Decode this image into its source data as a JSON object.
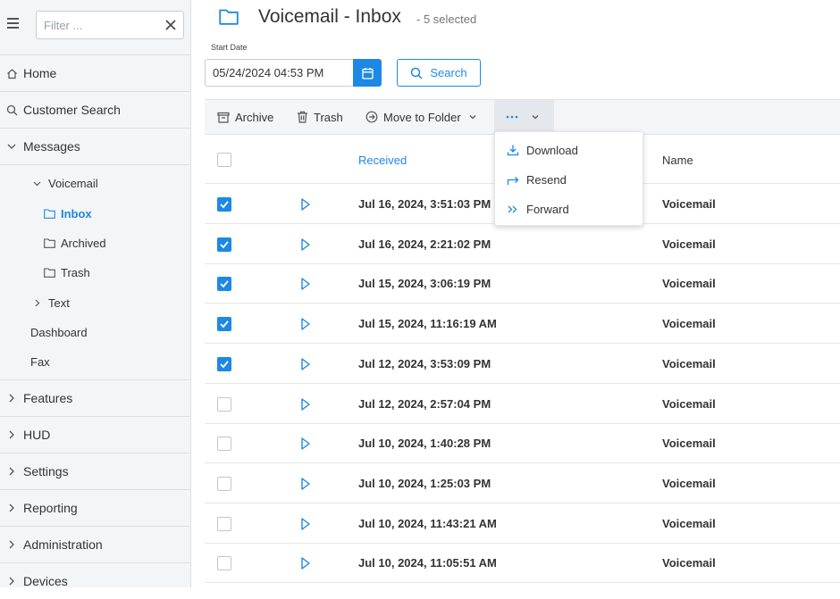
{
  "sidebar": {
    "filter_placeholder": "Filter ...",
    "nav": {
      "home": "Home",
      "customer_search": "Customer Search",
      "messages": "Messages",
      "voicemail": "Voicemail",
      "inbox": "Inbox",
      "archived": "Archived",
      "trash": "Trash",
      "text": "Text",
      "dashboard": "Dashboard",
      "fax": "Fax",
      "features": "Features",
      "hud": "HUD",
      "settings": "Settings",
      "reporting": "Reporting",
      "administration": "Administration",
      "devices": "Devices"
    }
  },
  "header": {
    "title": "Voicemail - Inbox",
    "selected": "- 5 selected"
  },
  "filters": {
    "start_date_label": "Start Date",
    "start_date_value": "05/24/2024 04:53 PM",
    "search_label": "Search"
  },
  "toolbar": {
    "archive": "Archive",
    "trash": "Trash",
    "move_to_folder": "Move to Folder"
  },
  "more_menu": {
    "download": "Download",
    "resend": "Resend",
    "forward": "Forward"
  },
  "table": {
    "col_received": "Received",
    "col_name": "Name",
    "rows": [
      {
        "received": "Jul 16, 2024, 3:51:03 PM",
        "name": "Voicemail",
        "checked": true
      },
      {
        "received": "Jul 16, 2024, 2:21:02 PM",
        "name": "Voicemail",
        "checked": true
      },
      {
        "received": "Jul 15, 2024, 3:06:19 PM",
        "name": "Voicemail",
        "checked": true
      },
      {
        "received": "Jul 15, 2024, 11:16:19 AM",
        "name": "Voicemail",
        "checked": true
      },
      {
        "received": "Jul 12, 2024, 3:53:09 PM",
        "name": "Voicemail",
        "checked": true
      },
      {
        "received": "Jul 12, 2024, 2:57:04 PM",
        "name": "Voicemail",
        "checked": false
      },
      {
        "received": "Jul 10, 2024, 1:40:28 PM",
        "name": "Voicemail",
        "checked": false
      },
      {
        "received": "Jul 10, 2024, 1:25:03 PM",
        "name": "Voicemail",
        "checked": false
      },
      {
        "received": "Jul 10, 2024, 11:43:21 AM",
        "name": "Voicemail",
        "checked": false
      },
      {
        "received": "Jul 10, 2024, 11:05:51 AM",
        "name": "Voicemail",
        "checked": false
      }
    ]
  },
  "colors": {
    "accent": "#1e88e5",
    "sidebar_bg": "#f4f5f7",
    "text": "#333333"
  }
}
